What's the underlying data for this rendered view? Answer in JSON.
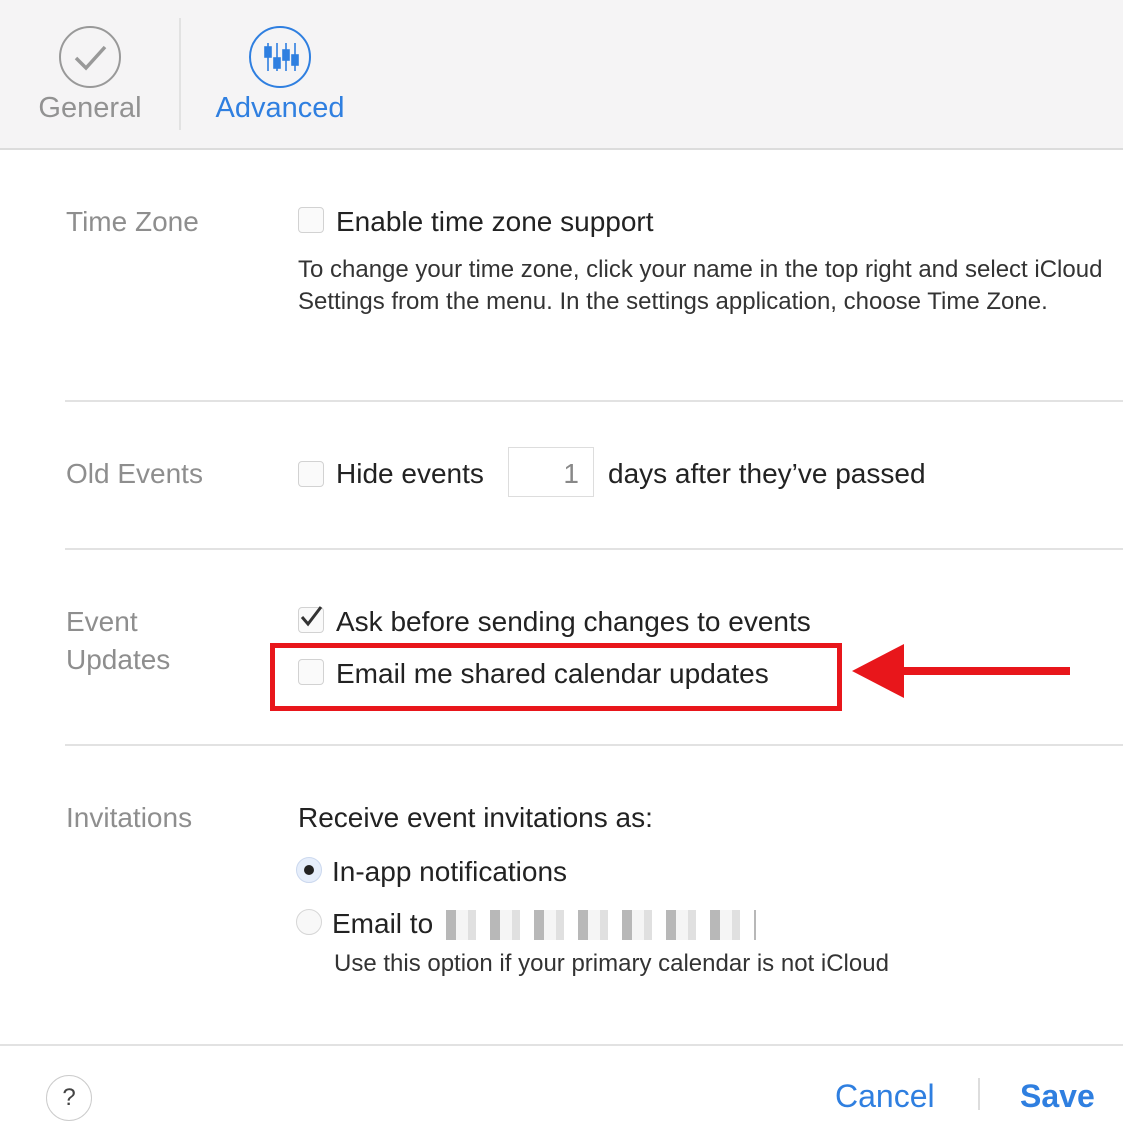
{
  "tabs": [
    {
      "label": "General",
      "icon": "checkmark-icon",
      "active": false
    },
    {
      "label": "Advanced",
      "icon": "sliders-icon",
      "active": true
    }
  ],
  "accent": "#2f7fe0",
  "time_zone": {
    "label": "Time Zone",
    "checkbox_label": "Enable time zone support",
    "checked": false,
    "help": "To change your time zone, click your name in the top right and select iCloud Settings from the menu. In the settings application, choose Time Zone."
  },
  "old_events": {
    "label": "Old Events",
    "checkbox_label": "Hide events",
    "days_value": "1",
    "suffix": "days after they’ve passed",
    "checked": false
  },
  "event_updates": {
    "label": "Event Updates",
    "ask_label": "Ask before sending changes to events",
    "ask_checked": true,
    "email_label": "Email me shared calendar updates",
    "email_checked": false,
    "highlight_color": "#e8161b"
  },
  "invitations": {
    "label": "Invitations",
    "heading": "Receive event invitations as:",
    "options": [
      {
        "label": "In-app notifications",
        "selected": true
      },
      {
        "label": "Email to",
        "selected": false
      }
    ],
    "email_note": "Use this option if your primary calendar is not iCloud"
  },
  "footer": {
    "help": "?",
    "cancel": "Cancel",
    "save": "Save"
  }
}
